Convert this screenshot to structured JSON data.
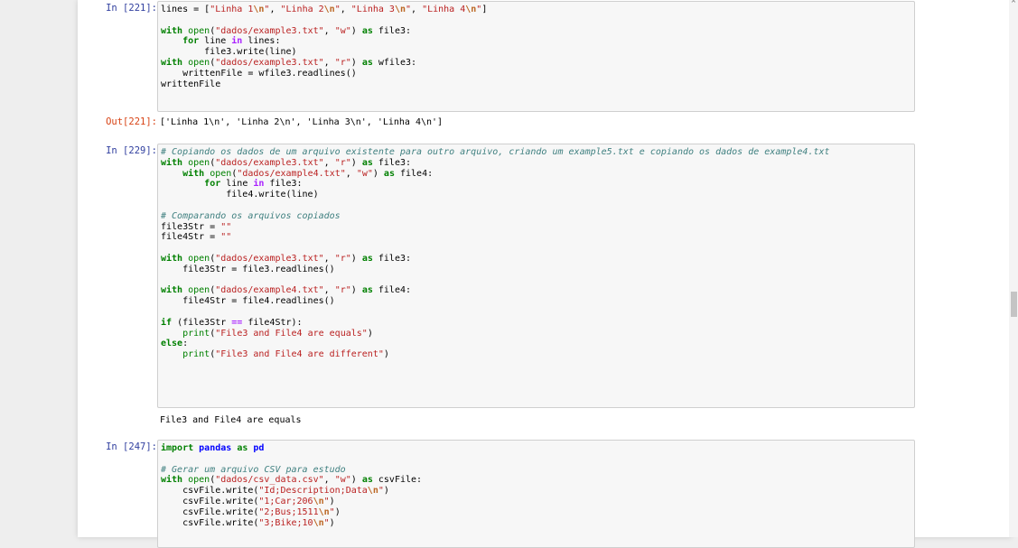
{
  "cells": [
    {
      "prompt": "In [221]:",
      "code": [
        [
          [
            "t",
            "lines = ["
          ],
          [
            "s",
            "\"Linha 1"
          ],
          [
            "e",
            "\\n"
          ],
          [
            "s",
            "\""
          ],
          [
            "t",
            ", "
          ],
          [
            "s",
            "\"Linha 2"
          ],
          [
            "e",
            "\\n"
          ],
          [
            "s",
            "\""
          ],
          [
            "t",
            ", "
          ],
          [
            "s",
            "\"Linha 3"
          ],
          [
            "e",
            "\\n"
          ],
          [
            "s",
            "\""
          ],
          [
            "t",
            ", "
          ],
          [
            "s",
            "\"Linha 4"
          ],
          [
            "e",
            "\\n"
          ],
          [
            "s",
            "\""
          ],
          [
            "t",
            "]"
          ]
        ],
        [],
        [
          [
            "k",
            "with"
          ],
          [
            "t",
            " "
          ],
          [
            "b",
            "open"
          ],
          [
            "t",
            "("
          ],
          [
            "s",
            "\"dados/example3.txt\""
          ],
          [
            "t",
            ", "
          ],
          [
            "s",
            "\"w\""
          ],
          [
            "t",
            ") "
          ],
          [
            "k",
            "as"
          ],
          [
            "t",
            " file3:"
          ]
        ],
        [
          [
            "t",
            "    "
          ],
          [
            "k",
            "for"
          ],
          [
            "t",
            " line "
          ],
          [
            "o",
            "in"
          ],
          [
            "t",
            " lines:"
          ]
        ],
        [
          [
            "t",
            "        file3.write(line)"
          ]
        ],
        [
          [
            "k",
            "with"
          ],
          [
            "t",
            " "
          ],
          [
            "b",
            "open"
          ],
          [
            "t",
            "("
          ],
          [
            "s",
            "\"dados/example3.txt\""
          ],
          [
            "t",
            ", "
          ],
          [
            "s",
            "\"r\""
          ],
          [
            "t",
            ") "
          ],
          [
            "k",
            "as"
          ],
          [
            "t",
            " wfile3:"
          ]
        ],
        [
          [
            "t",
            "    writtenFile = wfile3.readlines()"
          ]
        ],
        [
          [
            "t",
            "writtenFile"
          ]
        ]
      ]
    },
    {
      "prompt": "Out[221]:",
      "output": "['Linha 1\\n', 'Linha 2\\n', 'Linha 3\\n', 'Linha 4\\n']"
    },
    {
      "prompt": "In [229]:",
      "code": [
        [
          [
            "c",
            "# Copiando os dados de um arquivo existente para outro arquivo, criando um example5.txt e copiando os dados de example4.txt"
          ]
        ],
        [
          [
            "k",
            "with"
          ],
          [
            "t",
            " "
          ],
          [
            "b",
            "open"
          ],
          [
            "t",
            "("
          ],
          [
            "s",
            "\"dados/example3.txt\""
          ],
          [
            "t",
            ", "
          ],
          [
            "s",
            "\"r\""
          ],
          [
            "t",
            ") "
          ],
          [
            "k",
            "as"
          ],
          [
            "t",
            " file3:"
          ]
        ],
        [
          [
            "t",
            "    "
          ],
          [
            "k",
            "with"
          ],
          [
            "t",
            " "
          ],
          [
            "b",
            "open"
          ],
          [
            "t",
            "("
          ],
          [
            "s",
            "\"dados/example4.txt\""
          ],
          [
            "t",
            ", "
          ],
          [
            "s",
            "\"w\""
          ],
          [
            "t",
            ") "
          ],
          [
            "k",
            "as"
          ],
          [
            "t",
            " file4:"
          ]
        ],
        [
          [
            "t",
            "        "
          ],
          [
            "k",
            "for"
          ],
          [
            "t",
            " line "
          ],
          [
            "o",
            "in"
          ],
          [
            "t",
            " file3:"
          ]
        ],
        [
          [
            "t",
            "            file4.write(line)"
          ]
        ],
        [],
        [
          [
            "c",
            "# Comparando os arquivos copiados"
          ]
        ],
        [
          [
            "t",
            "file3Str = "
          ],
          [
            "s",
            "\"\""
          ]
        ],
        [
          [
            "t",
            "file4Str = "
          ],
          [
            "s",
            "\"\""
          ]
        ],
        [],
        [
          [
            "k",
            "with"
          ],
          [
            "t",
            " "
          ],
          [
            "b",
            "open"
          ],
          [
            "t",
            "("
          ],
          [
            "s",
            "\"dados/example3.txt\""
          ],
          [
            "t",
            ", "
          ],
          [
            "s",
            "\"r\""
          ],
          [
            "t",
            ") "
          ],
          [
            "k",
            "as"
          ],
          [
            "t",
            " file3:"
          ]
        ],
        [
          [
            "t",
            "    file3Str = file3.readlines()"
          ]
        ],
        [],
        [
          [
            "k",
            "with"
          ],
          [
            "t",
            " "
          ],
          [
            "b",
            "open"
          ],
          [
            "t",
            "("
          ],
          [
            "s",
            "\"dados/example4.txt\""
          ],
          [
            "t",
            ", "
          ],
          [
            "s",
            "\"r\""
          ],
          [
            "t",
            ") "
          ],
          [
            "k",
            "as"
          ],
          [
            "t",
            " file4:"
          ]
        ],
        [
          [
            "t",
            "    file4Str = file4.readlines()"
          ]
        ],
        [],
        [
          [
            "k",
            "if"
          ],
          [
            "t",
            " (file3Str "
          ],
          [
            "o",
            "=="
          ],
          [
            "t",
            " file4Str):"
          ]
        ],
        [
          [
            "t",
            "    "
          ],
          [
            "b",
            "print"
          ],
          [
            "t",
            "("
          ],
          [
            "s",
            "\"File3 and File4 are equals\""
          ],
          [
            "t",
            ")"
          ]
        ],
        [
          [
            "k",
            "else"
          ],
          [
            "t",
            ":"
          ]
        ],
        [
          [
            "t",
            "    "
          ],
          [
            "b",
            "print"
          ],
          [
            "t",
            "("
          ],
          [
            "s",
            "\"File3 and File4 are different\""
          ],
          [
            "t",
            ")"
          ]
        ]
      ],
      "stdout": "File3 and File4 are equals"
    },
    {
      "prompt": "In [247]:",
      "code": [
        [
          [
            "k",
            "import"
          ],
          [
            "t",
            " "
          ],
          [
            "n",
            "pandas"
          ],
          [
            "t",
            " "
          ],
          [
            "k",
            "as"
          ],
          [
            "t",
            " "
          ],
          [
            "n",
            "pd"
          ]
        ],
        [],
        [
          [
            "c",
            "# Gerar um arquivo CSV para estudo"
          ]
        ],
        [
          [
            "k",
            "with"
          ],
          [
            "t",
            " "
          ],
          [
            "b",
            "open"
          ],
          [
            "t",
            "("
          ],
          [
            "s",
            "\"dados/csv_data.csv\""
          ],
          [
            "t",
            ", "
          ],
          [
            "s",
            "\"w\""
          ],
          [
            "t",
            ") "
          ],
          [
            "k",
            "as"
          ],
          [
            "t",
            " csvFile:"
          ]
        ],
        [
          [
            "t",
            "    csvFile.write("
          ],
          [
            "s",
            "\"Id;Description;Data"
          ],
          [
            "e",
            "\\n"
          ],
          [
            "s",
            "\""
          ],
          [
            "t",
            ")"
          ]
        ],
        [
          [
            "t",
            "    csvFile.write("
          ],
          [
            "s",
            "\"1;Car;206"
          ],
          [
            "e",
            "\\n"
          ],
          [
            "s",
            "\""
          ],
          [
            "t",
            ")"
          ]
        ],
        [
          [
            "t",
            "    csvFile.write("
          ],
          [
            "s",
            "\"2;Bus;1511"
          ],
          [
            "e",
            "\\n"
          ],
          [
            "s",
            "\""
          ],
          [
            "t",
            ")"
          ]
        ],
        [
          [
            "t",
            "    csvFile.write("
          ],
          [
            "s",
            "\"3;Bike;10"
          ],
          [
            "e",
            "\\n"
          ],
          [
            "s",
            "\""
          ],
          [
            "t",
            ")"
          ]
        ]
      ]
    }
  ],
  "colors": {
    "keyword": "#008000",
    "string": "#ba2121",
    "comment": "#408080",
    "in_prompt": "#303f9f",
    "out_prompt": "#d84315"
  },
  "icons": {
    "scroll_up": "scroll-up-arrow-icon"
  }
}
